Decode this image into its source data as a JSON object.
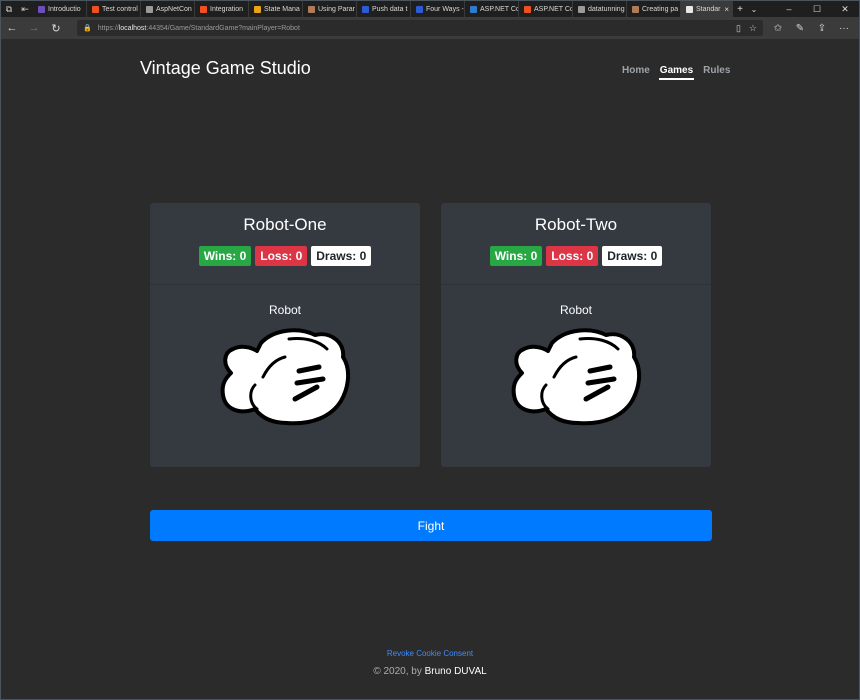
{
  "browser": {
    "tabs": [
      {
        "label": "Introductio",
        "color": "#6b4fbb"
      },
      {
        "label": "Test control",
        "color": "#f25022"
      },
      {
        "label": "AspNetCon",
        "color": "#9a9a9a"
      },
      {
        "label": "Integration",
        "color": "#f25022"
      },
      {
        "label": "State Mana",
        "color": "#e8a317"
      },
      {
        "label": "Using Parar",
        "color": "#b07b5a"
      },
      {
        "label": "Push data t",
        "color": "#2b5bd7"
      },
      {
        "label": "Four Ways -",
        "color": "#2b5bd7"
      },
      {
        "label": "ASP.NET Cc",
        "color": "#2e7bcf"
      },
      {
        "label": "ASP.NET Cc",
        "color": "#f25022"
      },
      {
        "label": "datatunning",
        "color": "#9a9a9a"
      },
      {
        "label": "Creating pa",
        "color": "#b07b5a"
      }
    ],
    "active_tab": {
      "label": "Standar",
      "color": "#e8e8e8"
    },
    "url_prefix": "https://",
    "url_host": "localhost",
    "url_rest": ":44354/Game/StandardGame?mainPlayer=Robot"
  },
  "site": {
    "brand": "Vintage Game Studio",
    "nav": [
      {
        "label": "Home",
        "active": false
      },
      {
        "label": "Games",
        "active": true
      },
      {
        "label": "Rules",
        "active": false
      }
    ]
  },
  "players": [
    {
      "name": "Robot-One",
      "wins": "Wins: 0",
      "loss": "Loss: 0",
      "draws": "Draws: 0",
      "choice": "Robot",
      "hand_icon": "fist-icon"
    },
    {
      "name": "Robot-Two",
      "wins": "Wins: 0",
      "loss": "Loss: 0",
      "draws": "Draws: 0",
      "choice": "Robot",
      "hand_icon": "fist-icon"
    }
  ],
  "fight_label": "Fight",
  "footer": {
    "revoke": "Revoke Cookie Consent",
    "copyright": "© 2020, by",
    "author": "Bruno DUVAL"
  },
  "colors": {
    "primary": "#007bff",
    "win": "#28a745",
    "loss": "#dc3545",
    "card": "#343a40",
    "page": "#2b2b2b"
  }
}
